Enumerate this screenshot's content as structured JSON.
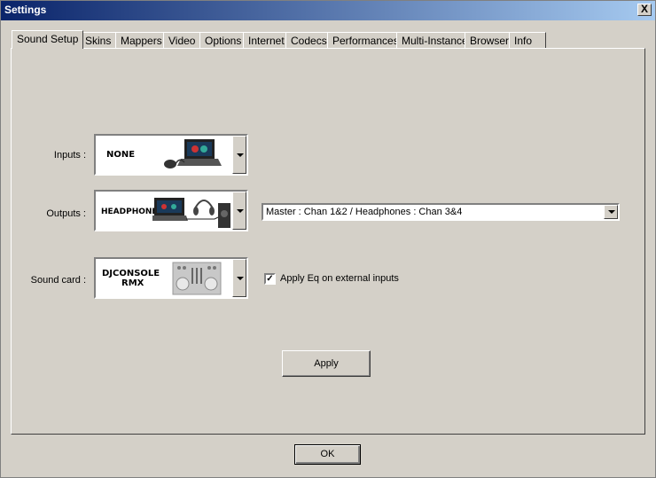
{
  "window": {
    "title": "Settings",
    "close_label": "X"
  },
  "tabs": [
    {
      "label": "Sound Setup",
      "active": true
    },
    {
      "label": "Skins"
    },
    {
      "label": "Mappers"
    },
    {
      "label": "Video"
    },
    {
      "label": "Options"
    },
    {
      "label": "Internet"
    },
    {
      "label": "Codecs"
    },
    {
      "label": "Performances"
    },
    {
      "label": "Multi-Instance"
    },
    {
      "label": "Browser"
    },
    {
      "label": "Info"
    }
  ],
  "sound_setup": {
    "inputs": {
      "label": "Inputs :",
      "device": "NONE"
    },
    "outputs": {
      "label": "Outputs :",
      "device": "HEADPHONES",
      "routing": "Master : Chan 1&2 / Headphones : Chan 3&4"
    },
    "sound_card": {
      "label": "Sound card :",
      "device_line1": "DJCONSOLE",
      "device_line2": "RMX"
    },
    "apply_eq": {
      "label": "Apply Eq on external inputs",
      "checked": true
    },
    "apply_label": "Apply"
  },
  "ok_label": "OK"
}
